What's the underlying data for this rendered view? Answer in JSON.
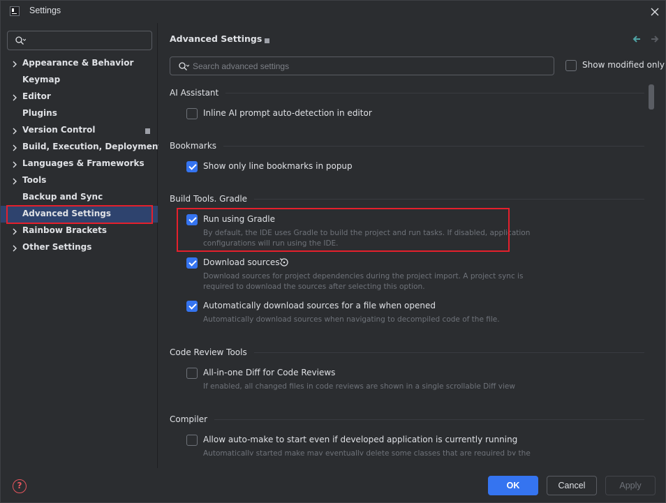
{
  "window": {
    "title": "Settings"
  },
  "sidebar": {
    "search_placeholder": "",
    "items": [
      {
        "label": "Appearance & Behavior",
        "expandable": true
      },
      {
        "label": "Keymap",
        "expandable": false
      },
      {
        "label": "Editor",
        "expandable": true
      },
      {
        "label": "Plugins",
        "expandable": false
      },
      {
        "label": "Version Control",
        "expandable": true
      },
      {
        "label": "Build, Execution, Deployment",
        "expandable": true
      },
      {
        "label": "Languages & Frameworks",
        "expandable": true
      },
      {
        "label": "Tools",
        "expandable": true
      },
      {
        "label": "Backup and Sync",
        "expandable": false
      },
      {
        "label": "Advanced Settings",
        "expandable": false,
        "selected": true
      },
      {
        "label": "Rainbow Brackets",
        "expandable": true
      },
      {
        "label": "Other Settings",
        "expandable": true
      }
    ]
  },
  "main": {
    "title": "Advanced Settings",
    "search_placeholder": "Search advanced settings",
    "show_modified_label": "Show modified only",
    "sections": [
      {
        "title": "AI Assistant",
        "settings": [
          {
            "name": "Inline AI prompt auto-detection in editor",
            "checked": false,
            "desc": ""
          }
        ]
      },
      {
        "title": "Bookmarks",
        "settings": [
          {
            "name": "Show only line bookmarks in popup",
            "checked": true,
            "desc": ""
          }
        ]
      },
      {
        "title": "Build Tools. Gradle",
        "settings": [
          {
            "name": "Run using Gradle",
            "checked": true,
            "desc": "By default, the IDE uses Gradle to build the project and run tasks. If disabled, application configurations will run using the IDE."
          },
          {
            "name": "Download sources",
            "checked": true,
            "desc": "Download sources for project dependencies during the project import. A project sync is required to download the sources after selecting this option."
          },
          {
            "name": "Automatically download sources for a file when opened",
            "checked": true,
            "desc": "Automatically download sources when navigating to decompiled code of the file."
          }
        ]
      },
      {
        "title": "Code Review Tools",
        "settings": [
          {
            "name": "All-in-one Diff for Code Reviews",
            "checked": false,
            "desc": "If enabled, all changed files in code reviews are shown in a single scrollable Diff view"
          }
        ]
      },
      {
        "title": "Compiler",
        "settings": [
          {
            "name": "Allow auto-make to start even if developed application is currently running",
            "checked": false,
            "desc": "Automatically started make may eventually delete some classes that are required by the application"
          }
        ]
      }
    ]
  },
  "buttons": {
    "ok": "OK",
    "cancel": "Cancel",
    "apply": "Apply"
  },
  "colors": {
    "accent": "#3574f0",
    "highlight": "#e5202c",
    "background": "#2b2d30",
    "selected_row": "#2e436e"
  }
}
